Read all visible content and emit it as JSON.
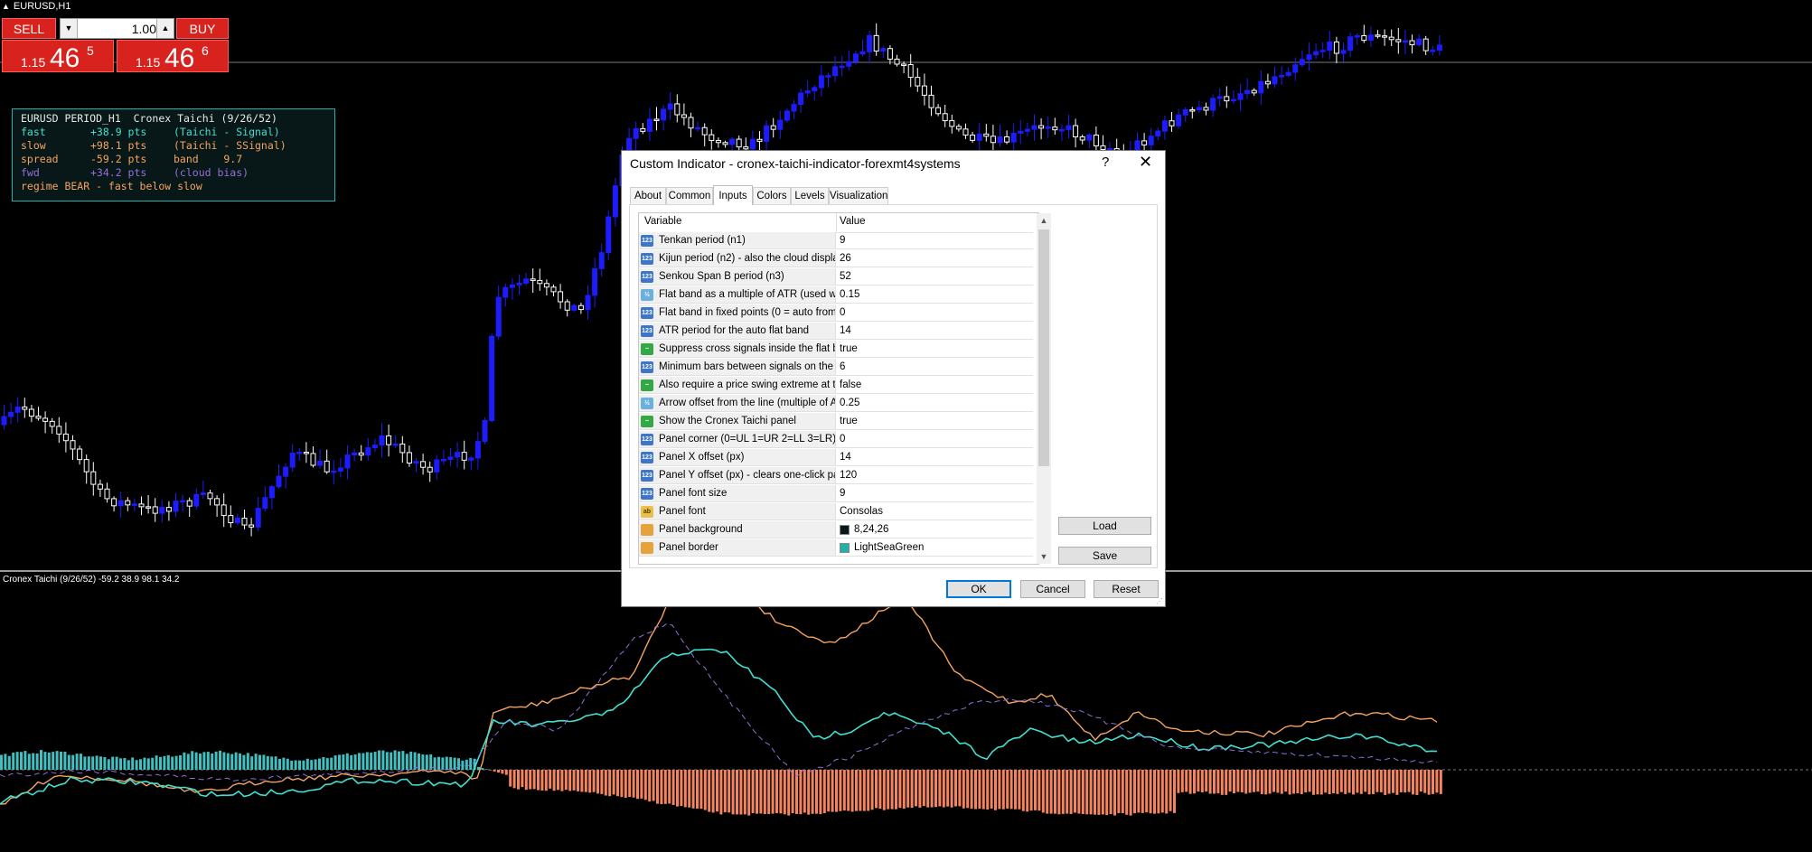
{
  "chart": {
    "title": "EURUSD,H1",
    "subwindow_label": "Cronex Taichi (9/26/52) -59.2 38.9 98.1 34.2"
  },
  "trade_panel": {
    "sell_label": "SELL",
    "buy_label": "BUY",
    "lot_value": "1.00",
    "bid": {
      "prefix": "1.15",
      "big": "46",
      "sup": "5"
    },
    "ask": {
      "prefix": "1.15",
      "big": "46",
      "sup": "6"
    }
  },
  "info_panel": {
    "line1": "EURUSD PERIOD_H1  Cronex Taichi (9/26/52)",
    "rows": [
      {
        "label": "fast",
        "value": "+38.9 pts",
        "note": "(Taichi - Signal)"
      },
      {
        "label": "slow",
        "value": "+98.1 pts",
        "note": "(Taichi - SSignal)"
      },
      {
        "label": "spread",
        "value": "-59.2 pts",
        "note": "band    9.7"
      },
      {
        "label": "fwd",
        "value": "+34.2 pts",
        "note": "(cloud bias)"
      }
    ],
    "regime": "regime BEAR - fast below slow",
    "colors": {
      "fast": "#40e0d0",
      "slow": "#f4a460",
      "spread": "#f4a460",
      "fwd": "#9370db"
    }
  },
  "dialog": {
    "title": "Custom Indicator - cronex-taichi-indicator-forexmt4systems",
    "help_label": "?",
    "close_label": "✕",
    "tabs": [
      "About",
      "Common",
      "Inputs",
      "Colors",
      "Levels",
      "Visualization"
    ],
    "active_tab": "Inputs",
    "columns": {
      "variable": "Variable",
      "value": "Value"
    },
    "params": [
      {
        "type": "int",
        "icon": "123",
        "name": "Tenkan period (n1)",
        "value": "9"
      },
      {
        "type": "int",
        "icon": "123",
        "name": "Kijun period (n2) - also the cloud displa...",
        "value": "26"
      },
      {
        "type": "int",
        "icon": "123",
        "name": "Senkou Span B period (n3)",
        "value": "52"
      },
      {
        "type": "dbl",
        "icon": "½",
        "name": "Flat band as a multiple of ATR (used w...",
        "value": "0.15"
      },
      {
        "type": "int",
        "icon": "123",
        "name": "Flat band in fixed points (0 = auto from ...",
        "value": "0"
      },
      {
        "type": "int",
        "icon": "123",
        "name": "ATR period for the auto flat band",
        "value": "14"
      },
      {
        "type": "bool",
        "icon": "~",
        "name": "Suppress cross signals inside the flat b...",
        "value": "true"
      },
      {
        "type": "int",
        "icon": "123",
        "name": "Minimum bars between signals on the s...",
        "value": "6"
      },
      {
        "type": "bool",
        "icon": "~",
        "name": "Also require a price swing extreme at th...",
        "value": "false"
      },
      {
        "type": "dbl",
        "icon": "½",
        "name": "Arrow offset from the line (multiple of A...",
        "value": "0.25"
      },
      {
        "type": "bool",
        "icon": "~",
        "name": "Show the Cronex Taichi panel",
        "value": "true"
      },
      {
        "type": "int",
        "icon": "123",
        "name": "Panel corner (0=UL 1=UR 2=LL 3=LR)",
        "value": "0"
      },
      {
        "type": "int",
        "icon": "123",
        "name": "Panel X offset (px)",
        "value": "14"
      },
      {
        "type": "int",
        "icon": "123",
        "name": "Panel Y offset (px) - clears one-click pa...",
        "value": "120"
      },
      {
        "type": "int",
        "icon": "123",
        "name": "Panel font size",
        "value": "9"
      },
      {
        "type": "str",
        "icon": "ab",
        "name": "Panel font",
        "value": "Consolas"
      },
      {
        "type": "col",
        "icon": "",
        "name": "Panel background",
        "value": "8,24,26",
        "swatch": "#08181a"
      },
      {
        "type": "col",
        "icon": "",
        "name": "Panel border",
        "value": "LightSeaGreen",
        "swatch": "#20b2aa"
      }
    ],
    "buttons": {
      "load": "Load",
      "save": "Save",
      "ok": "OK",
      "cancel": "Cancel",
      "reset": "Reset"
    }
  },
  "colors": {
    "fast_line": "#40e0d0",
    "slow_line": "#f4a460",
    "fwd_line": "#9370db",
    "hist_pos": "#40c0c0",
    "hist_neg": "#f4855e",
    "bull_candle": "#1c1cff",
    "bear_candle": "#ffffff",
    "sell_buy_button": "#d8221e"
  }
}
